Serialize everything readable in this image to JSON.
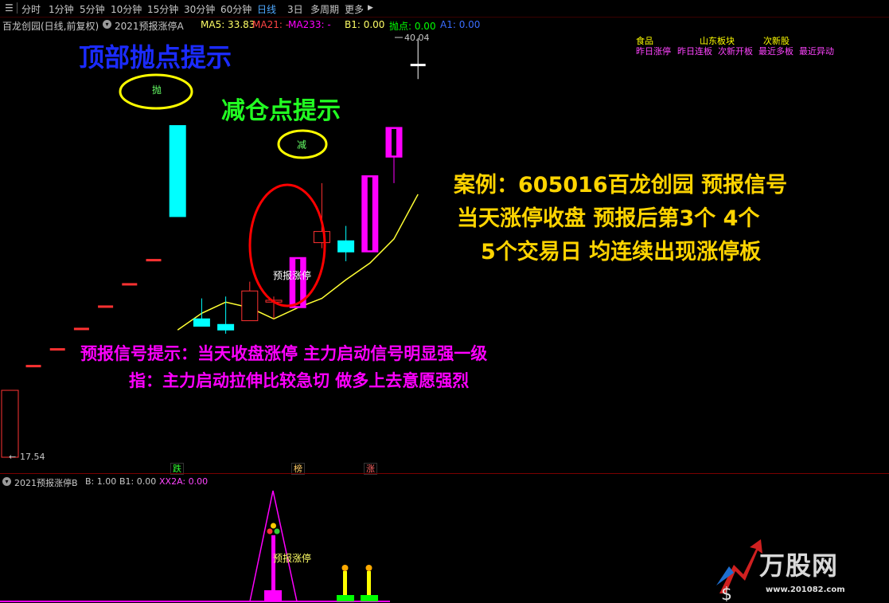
{
  "toolbar": {
    "items": [
      "分时",
      "1分钟",
      "5分钟",
      "10分钟",
      "15分钟",
      "30分钟",
      "60分钟",
      "日线",
      "3日",
      "多周期",
      "更多"
    ],
    "more_arrow": "▶",
    "active": "日线"
  },
  "legend": {
    "stock_title": "百龙创园(日线,前复权)",
    "indicator": "2021预报涨停A",
    "ma5": "MA5: 33.83",
    "ma21": "MA21: -",
    "ma233": "MA233: -",
    "b1": "B1: 0.00",
    "paodian": "抛点: 0.00",
    "a1": "A1: 0.00"
  },
  "price": {
    "high_label": "40.04",
    "low_label": "17.54",
    "arrow": "←"
  },
  "overlays": {
    "top_sell_title": "顶部抛点提示",
    "reduce_title": "减仓点提示",
    "sell_mark": "抛",
    "reduce_mark": "减",
    "forecast_label": "预报涨停",
    "case_lines": [
      "案例：605016百龙创园  预报信号",
      "当天涨停收盘  预报后第3个  4个",
      "5个交易日  均连续出现涨停板"
    ],
    "note_lines": [
      "预报信号提示：当天收盘涨停  主力启动信号明显强一级",
      "指：主力启动拉伸比较急切 做多上去意愿强烈"
    ]
  },
  "info_tags": {
    "row1": [
      "食品",
      "山东板块",
      "次新股"
    ],
    "row2": [
      "昨日涨停",
      "昨日连板",
      "次新开板",
      "最近多板",
      "最近异动"
    ]
  },
  "bottom_tags": [
    "跌",
    "榜",
    "涨"
  ],
  "sub_chart": {
    "title": "2021预报涨停B",
    "b": "B: 1.00",
    "b1": "B1: 0.00",
    "xx2a": "XX2A: 0.00",
    "forecast_label": "预报涨停"
  },
  "watermark": {
    "brand": "万股网",
    "url": "www.201082.com"
  },
  "chart_data": {
    "type": "candlestick",
    "ylim": [
      17.54,
      40.04
    ],
    "candles": [
      {
        "o": 22.4,
        "h": 22.4,
        "l": 22.4,
        "c": 22.4,
        "color": "red"
      },
      {
        "o": 23.3,
        "h": 23.3,
        "l": 23.3,
        "c": 23.3,
        "color": "red"
      },
      {
        "o": 24.4,
        "h": 24.4,
        "l": 24.4,
        "c": 24.4,
        "color": "red"
      },
      {
        "o": 25.6,
        "h": 25.6,
        "l": 25.6,
        "c": 25.6,
        "color": "red"
      },
      {
        "o": 26.8,
        "h": 26.8,
        "l": 26.8,
        "c": 26.8,
        "color": "red"
      },
      {
        "o": 28.1,
        "h": 28.1,
        "l": 28.1,
        "c": 28.1,
        "color": "red"
      },
      {
        "o": 35.3,
        "h": 35.3,
        "l": 30.4,
        "c": 30.4,
        "color": "cyan"
      },
      {
        "o": 24.9,
        "h": 26.0,
        "l": 24.5,
        "c": 24.5,
        "color": "cyan"
      },
      {
        "o": 24.6,
        "h": 26.1,
        "l": 24.1,
        "c": 24.3,
        "color": "cyan"
      },
      {
        "o": 24.8,
        "h": 26.9,
        "l": 24.8,
        "c": 26.4,
        "color": "red"
      },
      {
        "o": 25.8,
        "h": 26.1,
        "l": 24.9,
        "c": 25.9,
        "color": "red"
      },
      {
        "o": 25.5,
        "h": 28.2,
        "l": 25.5,
        "c": 28.2,
        "color": "magenta"
      },
      {
        "o": 29.0,
        "h": 32.2,
        "l": 28.7,
        "c": 29.6,
        "color": "red"
      },
      {
        "o": 29.1,
        "h": 29.9,
        "l": 28.0,
        "c": 28.5,
        "color": "cyan"
      },
      {
        "o": 28.5,
        "h": 32.6,
        "l": 28.5,
        "c": 32.6,
        "color": "magenta"
      },
      {
        "o": 33.6,
        "h": 35.2,
        "l": 32.2,
        "c": 35.2,
        "color": "magenta"
      },
      {
        "o": 38.6,
        "h": 40.0,
        "l": 37.8,
        "c": 38.6,
        "color": "white"
      }
    ],
    "ma5": [
      null,
      null,
      null,
      null,
      null,
      null,
      24.3,
      25.2,
      25.8,
      25.5,
      24.9,
      25.5,
      26.0,
      27.0,
      27.9,
      29.2,
      31.6
    ]
  }
}
